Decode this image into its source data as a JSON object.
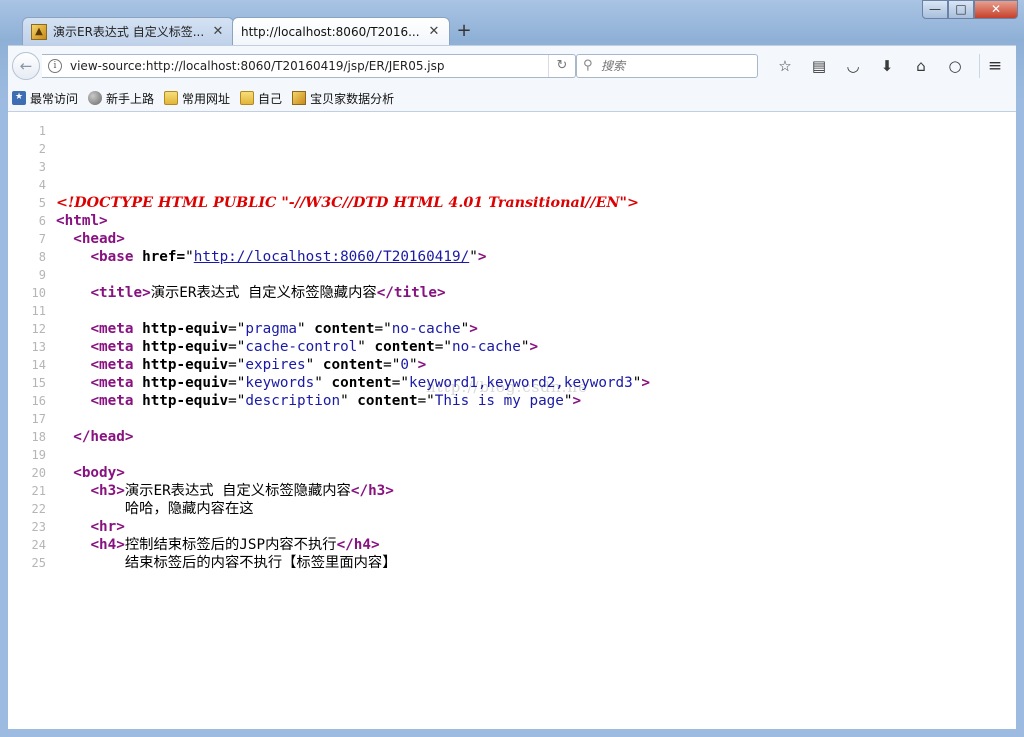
{
  "window": {
    "min": "—",
    "max": "□",
    "close": "✕"
  },
  "tabs": [
    {
      "label": "演示ER表达式 自定义标签...",
      "close": "✕"
    },
    {
      "label": "http://localhost:8060/T2016...",
      "close": "✕"
    }
  ],
  "newtab": "+",
  "nav": {
    "back": "←",
    "url": "view-source:http://localhost:8060/T20160419/jsp/ER/JER05.jsp",
    "reload": "↻",
    "search_placeholder": "搜索"
  },
  "toolbar_icons": [
    "star-icon",
    "reading-list-icon",
    "pocket-icon",
    "download-icon",
    "home-icon",
    "chat-icon"
  ],
  "bookmarks": [
    {
      "label": "最常访问",
      "icon": "star"
    },
    {
      "label": "新手上路",
      "icon": "globe"
    },
    {
      "label": "常用网址",
      "icon": "folder"
    },
    {
      "label": "自己",
      "icon": "folder"
    },
    {
      "label": "宝贝家数据分析",
      "icon": "pic"
    }
  ],
  "source": {
    "line_numbers": [
      "1",
      "2",
      "3",
      "4",
      "5",
      "6",
      "7",
      "8",
      "9",
      "10",
      "11",
      "12",
      "13",
      "14",
      "15",
      "16",
      "17",
      "18",
      "19",
      "20",
      "21",
      "22",
      "23",
      "24",
      "25"
    ],
    "doctype": "<!DOCTYPE HTML PUBLIC \"-//W3C//DTD HTML 4.01 Transitional//EN\">",
    "html_open": "<html>",
    "head_open": "<head>",
    "base_open": "<base",
    "base_attr": " href=",
    "base_url": "http://localhost:8060/T20160419/",
    "base_close": ">",
    "title_open": "<title>",
    "title_text": "演示ER表达式 自定义标签隐藏内容",
    "title_close": "</title>",
    "metas": [
      {
        "a1": "http-equiv",
        "v1": "pragma",
        "a2": "content",
        "v2": "no-cache"
      },
      {
        "a1": "http-equiv",
        "v1": "cache-control",
        "a2": "content",
        "v2": "no-cache"
      },
      {
        "a1": "http-equiv",
        "v1": "expires",
        "a2": "content",
        "v2": "0"
      },
      {
        "a1": "http-equiv",
        "v1": "keywords",
        "a2": "content",
        "v2": "keyword1,keyword2,keyword3"
      },
      {
        "a1": "http-equiv",
        "v1": "description",
        "a2": "content",
        "v2": "This is my page"
      }
    ],
    "head_close": "</head>",
    "body_open": "<body>",
    "h3_open": "<h3>",
    "h3_text": "演示ER表达式 自定义标签隐藏内容",
    "h3_close": "</h3>",
    "hidden_text": "哈哈，隐藏内容在这",
    "hr": "<hr>",
    "h4_open": "<h4>",
    "h4_text": "控制结束标签后的JSP内容不执行",
    "h4_close": "</h4>",
    "tail_text": "结束标签后的内容不执行【标签里面内容】"
  },
  "watermark": "http://blog.csdn.ne"
}
